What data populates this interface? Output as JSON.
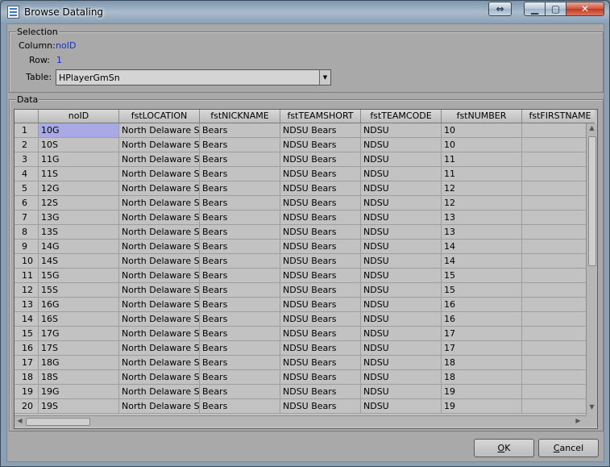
{
  "window": {
    "title": "Browse Dataling"
  },
  "titlebar_buttons": {
    "restore_glyph": "⇔",
    "min_glyph": "▁",
    "max_glyph": "▢",
    "close_glyph": "✕"
  },
  "selection": {
    "group_title": "Selection",
    "column_label": "Column:",
    "column_value": "noID",
    "row_label": "Row:",
    "row_value": "1",
    "table_label": "Table:",
    "table_value": "HPlayerGmSn"
  },
  "data_group": {
    "title": "Data",
    "columns": [
      "",
      "noID",
      "fstLOCATION",
      "fstNICKNAME",
      "fstTEAMSHORT",
      "fstTEAMCODE",
      "fstNUMBER",
      "fstFIRSTNAME"
    ],
    "rows": [
      [
        "1",
        "10G",
        "North Delaware Stat",
        "Bears",
        "NDSU Bears",
        "NDSU",
        "10",
        ""
      ],
      [
        "2",
        "10S",
        "North Delaware Stat",
        "Bears",
        "NDSU Bears",
        "NDSU",
        "10",
        ""
      ],
      [
        "3",
        "11G",
        "North Delaware Stat",
        "Bears",
        "NDSU Bears",
        "NDSU",
        "11",
        ""
      ],
      [
        "4",
        "11S",
        "North Delaware Stat",
        "Bears",
        "NDSU Bears",
        "NDSU",
        "11",
        ""
      ],
      [
        "5",
        "12G",
        "North Delaware Stat",
        "Bears",
        "NDSU Bears",
        "NDSU",
        "12",
        ""
      ],
      [
        "6",
        "12S",
        "North Delaware Stat",
        "Bears",
        "NDSU Bears",
        "NDSU",
        "12",
        ""
      ],
      [
        "7",
        "13G",
        "North Delaware Stat",
        "Bears",
        "NDSU Bears",
        "NDSU",
        "13",
        ""
      ],
      [
        "8",
        "13S",
        "North Delaware Stat",
        "Bears",
        "NDSU Bears",
        "NDSU",
        "13",
        ""
      ],
      [
        "9",
        "14G",
        "North Delaware Stat",
        "Bears",
        "NDSU Bears",
        "NDSU",
        "14",
        ""
      ],
      [
        "10",
        "14S",
        "North Delaware Stat",
        "Bears",
        "NDSU Bears",
        "NDSU",
        "14",
        ""
      ],
      [
        "11",
        "15G",
        "North Delaware Stat",
        "Bears",
        "NDSU Bears",
        "NDSU",
        "15",
        ""
      ],
      [
        "12",
        "15S",
        "North Delaware Stat",
        "Bears",
        "NDSU Bears",
        "NDSU",
        "15",
        ""
      ],
      [
        "13",
        "16G",
        "North Delaware Stat",
        "Bears",
        "NDSU Bears",
        "NDSU",
        "16",
        ""
      ],
      [
        "14",
        "16S",
        "North Delaware Stat",
        "Bears",
        "NDSU Bears",
        "NDSU",
        "16",
        ""
      ],
      [
        "15",
        "17G",
        "North Delaware Stat",
        "Bears",
        "NDSU Bears",
        "NDSU",
        "17",
        ""
      ],
      [
        "16",
        "17S",
        "North Delaware Stat",
        "Bears",
        "NDSU Bears",
        "NDSU",
        "17",
        ""
      ],
      [
        "17",
        "18G",
        "North Delaware Stat",
        "Bears",
        "NDSU Bears",
        "NDSU",
        "18",
        ""
      ],
      [
        "18",
        "18S",
        "North Delaware Stat",
        "Bears",
        "NDSU Bears",
        "NDSU",
        "18",
        ""
      ],
      [
        "19",
        "19G",
        "North Delaware Stat",
        "Bears",
        "NDSU Bears",
        "NDSU",
        "19",
        ""
      ],
      [
        "20",
        "19S",
        "North Delaware Stat",
        "Bears",
        "NDSU Bears",
        "NDSU",
        "19",
        ""
      ]
    ]
  },
  "buttons": {
    "ok_accel": "O",
    "ok_rest": "K",
    "cancel_accel": "C",
    "cancel_rest": "ancel"
  },
  "colors": {
    "selected_cell": "#a9a9e6",
    "value_text": "#1030d0"
  }
}
